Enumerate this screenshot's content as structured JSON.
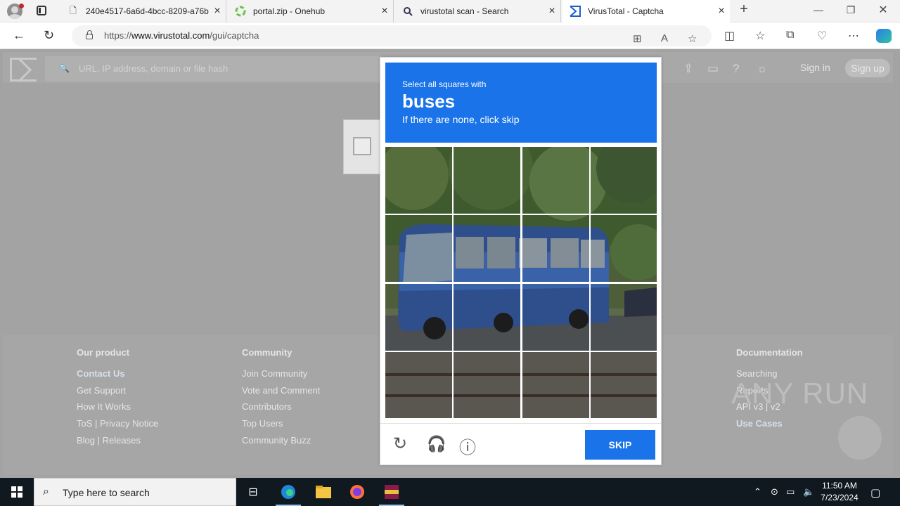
{
  "browser": {
    "tabs": [
      {
        "label": "240e4517-6a6d-4bcc-8209-a76bb",
        "icon": "document-icon",
        "active": false
      },
      {
        "label": "portal.zip - Onehub",
        "icon": "onehub-icon",
        "active": false
      },
      {
        "label": "virustotal scan - Search",
        "icon": "search-icon",
        "active": false
      },
      {
        "label": "VirusTotal - Captcha",
        "icon": "virustotal-icon",
        "active": true
      }
    ],
    "url_prefix": "https://",
    "url_domain": "www.virustotal.com",
    "url_path": "/gui/captcha"
  },
  "vt": {
    "search_placeholder": "URL, IP address, domain or file hash",
    "sign_in": "Sign in",
    "sign_up": "Sign up"
  },
  "footer": {
    "columns": [
      {
        "heading": "Our product",
        "items": [
          "Contact Us",
          "Get Support",
          "How It Works",
          "ToS | Privacy Notice",
          "Blog | Releases"
        ]
      },
      {
        "heading": "Community",
        "items": [
          "Join Community",
          "Vote and Comment",
          "Contributors",
          "Top Users",
          "Community Buzz"
        ]
      },
      {
        "heading": "Documentation",
        "items": [
          "Searching",
          "Reports",
          "API v3 | v2",
          "Use Cases"
        ]
      }
    ]
  },
  "captcha": {
    "instruction": "Select all squares with",
    "target": "buses",
    "hint": "If there are none, click skip",
    "skip_label": "SKIP",
    "grid_rows": 4,
    "grid_cols": 4
  },
  "watermark": "ANY RUN",
  "taskbar": {
    "search_placeholder": "Type here to search",
    "time": "11:50 AM",
    "date": "7/23/2024"
  }
}
